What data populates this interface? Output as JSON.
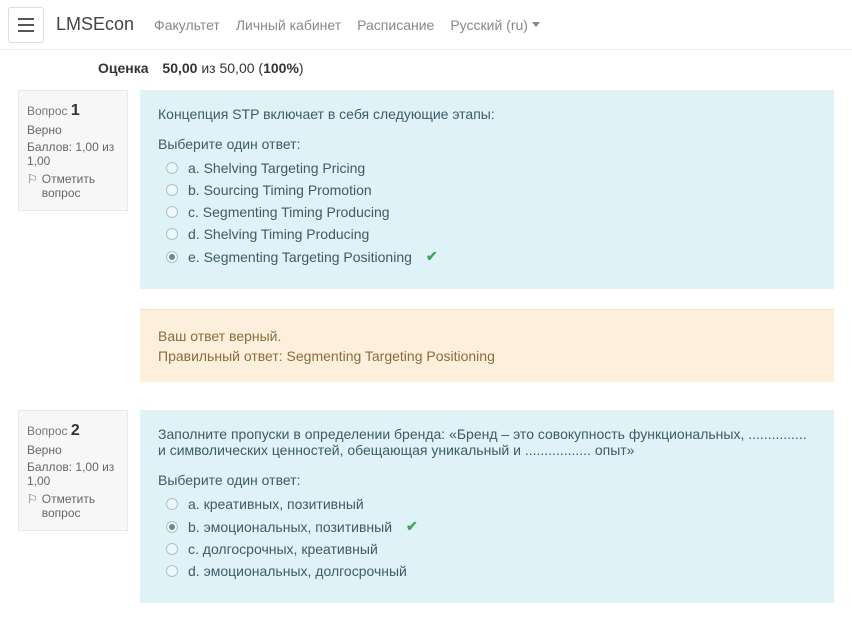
{
  "nav": {
    "brand": "LMSEcon",
    "links": [
      "Факультет",
      "Личный кабинет",
      "Расписание"
    ],
    "lang": "Русский (ru)"
  },
  "grade": {
    "label": "Оценка",
    "score": "50,00",
    "out": "из 50,00",
    "pct": "100%"
  },
  "q1": {
    "label": "Вопрос",
    "num": "1",
    "state": "Верно",
    "marks": "Баллов: 1,00 из 1,00",
    "flag": "Отметить вопрос",
    "text": "Концепция STP включает в себя следующие этапы:",
    "prompt": "Выберите один ответ:",
    "a": "a. Shelving Targeting Pricing",
    "b": "b. Sourcing Timing Promotion",
    "c": "c. Segmenting Timing Producing",
    "d": "d. Shelving Timing Producing",
    "e": "e. Segmenting Targeting Positioning",
    "fb1": "Ваш ответ верный.",
    "fb2": "Правильный ответ: Segmenting Targeting Positioning"
  },
  "q2": {
    "label": "Вопрос",
    "num": "2",
    "state": "Верно",
    "marks": "Баллов: 1,00 из 1,00",
    "flag": "Отметить вопрос",
    "text": "Заполните пропуски в определении бренда: «Бренд – это совокупность функциональных, ............... и символических ценностей, обещающая уникальный и ................. опыт»",
    "prompt": "Выберите один ответ:",
    "a": "a. креативных, позитивный",
    "b": "b. эмоциональных, позитивный",
    "c": "c. долгосрочных, креативный",
    "d": "d. эмоциональных, долгосрочный"
  }
}
